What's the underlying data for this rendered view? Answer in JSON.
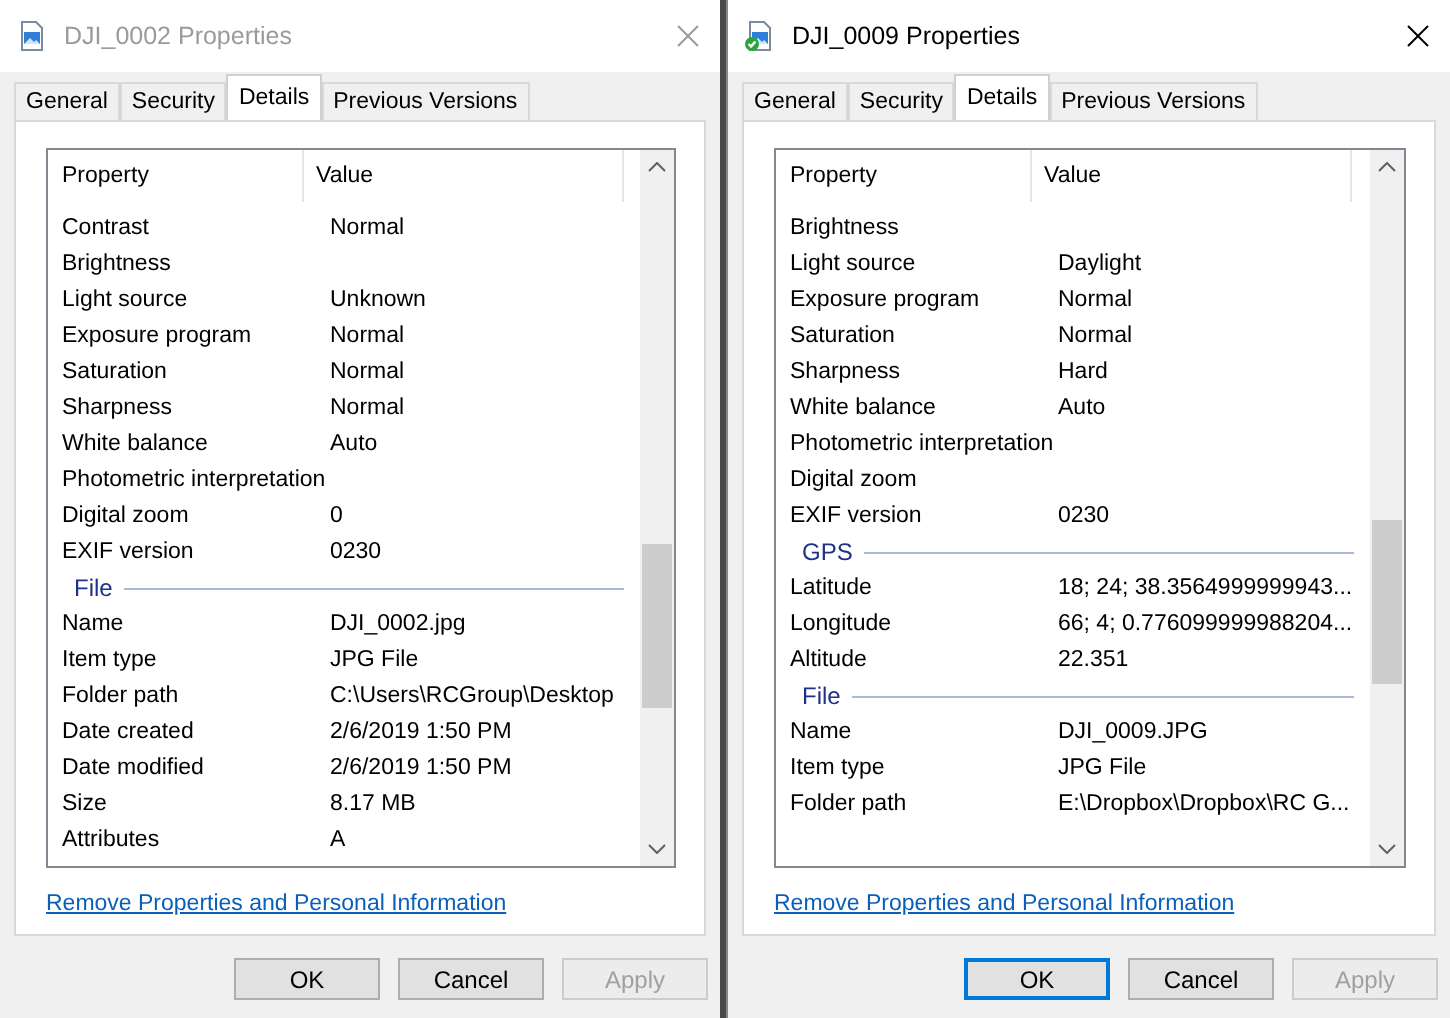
{
  "dialogs": [
    {
      "title": "DJI_0002 Properties",
      "active": false,
      "synced": false,
      "tabs": [
        {
          "label": "General",
          "selected": false
        },
        {
          "label": "Security",
          "selected": false
        },
        {
          "label": "Details",
          "selected": true
        },
        {
          "label": "Previous Versions",
          "selected": false
        }
      ],
      "columns": [
        "Property",
        "Value"
      ],
      "rows": [
        {
          "kind": "property",
          "property": "Contrast",
          "value": "Normal"
        },
        {
          "kind": "property",
          "property": "Brightness"
        },
        {
          "kind": "property",
          "property": "Light source",
          "value": "Unknown"
        },
        {
          "kind": "property",
          "property": "Exposure program",
          "value": "Normal"
        },
        {
          "kind": "property",
          "property": "Saturation",
          "value": "Normal"
        },
        {
          "kind": "property",
          "property": "Sharpness",
          "value": "Normal"
        },
        {
          "kind": "property",
          "property": "White balance",
          "value": "Auto"
        },
        {
          "kind": "property",
          "property": "Photometric interpretation"
        },
        {
          "kind": "property",
          "property": "Digital zoom",
          "value": "0"
        },
        {
          "kind": "property",
          "property": "EXIF version",
          "value": "0230"
        },
        {
          "kind": "group",
          "label": "File"
        },
        {
          "kind": "property",
          "property": "Name",
          "value": "DJI_0002.jpg"
        },
        {
          "kind": "property",
          "property": "Item type",
          "value": "JPG File"
        },
        {
          "kind": "property",
          "property": "Folder path",
          "value": "C:\\Users\\RCGroup\\Desktop"
        },
        {
          "kind": "property",
          "property": "Date created",
          "value": "2/6/2019 1:50 PM"
        },
        {
          "kind": "property",
          "property": "Date modified",
          "value": "2/6/2019 1:50 PM"
        },
        {
          "kind": "property",
          "property": "Size",
          "value": "8.17 MB"
        },
        {
          "kind": "property",
          "property": "Attributes",
          "value": "A"
        }
      ],
      "link": "Remove Properties and Personal Information",
      "buttons": [
        {
          "label": "OK",
          "default": false,
          "disabled": false
        },
        {
          "label": "Cancel",
          "default": false,
          "disabled": false
        },
        {
          "label": "Apply",
          "default": false,
          "disabled": true
        }
      ]
    },
    {
      "title": "DJI_0009 Properties",
      "active": true,
      "synced": true,
      "tabs": [
        {
          "label": "General",
          "selected": false
        },
        {
          "label": "Security",
          "selected": false
        },
        {
          "label": "Details",
          "selected": true
        },
        {
          "label": "Previous Versions",
          "selected": false
        }
      ],
      "columns": [
        "Property",
        "Value"
      ],
      "rows": [
        {
          "kind": "property",
          "property": "Brightness"
        },
        {
          "kind": "property",
          "property": "Light source",
          "value": "Daylight"
        },
        {
          "kind": "property",
          "property": "Exposure program",
          "value": "Normal"
        },
        {
          "kind": "property",
          "property": "Saturation",
          "value": "Normal"
        },
        {
          "kind": "property",
          "property": "Sharpness",
          "value": "Hard"
        },
        {
          "kind": "property",
          "property": "White balance",
          "value": "Auto"
        },
        {
          "kind": "property",
          "property": "Photometric interpretation"
        },
        {
          "kind": "property",
          "property": "Digital zoom"
        },
        {
          "kind": "property",
          "property": "EXIF version",
          "value": "0230"
        },
        {
          "kind": "group",
          "label": "GPS"
        },
        {
          "kind": "property",
          "property": "Latitude",
          "value": "18; 24; 38.3564999999943..."
        },
        {
          "kind": "property",
          "property": "Longitude",
          "value": "66; 4; 0.776099999988204..."
        },
        {
          "kind": "property",
          "property": "Altitude",
          "value": "22.351"
        },
        {
          "kind": "group",
          "label": "File"
        },
        {
          "kind": "property",
          "property": "Name",
          "value": "DJI_0009.JPG"
        },
        {
          "kind": "property",
          "property": "Item type",
          "value": "JPG File"
        },
        {
          "kind": "property",
          "property": "Folder path",
          "value": "E:\\Dropbox\\Dropbox\\RC G..."
        }
      ],
      "link": "Remove Properties and Personal Information",
      "buttons": [
        {
          "label": "OK",
          "default": true,
          "disabled": false
        },
        {
          "label": "Cancel",
          "default": false,
          "disabled": false
        },
        {
          "label": "Apply",
          "default": false,
          "disabled": true
        }
      ]
    }
  ]
}
